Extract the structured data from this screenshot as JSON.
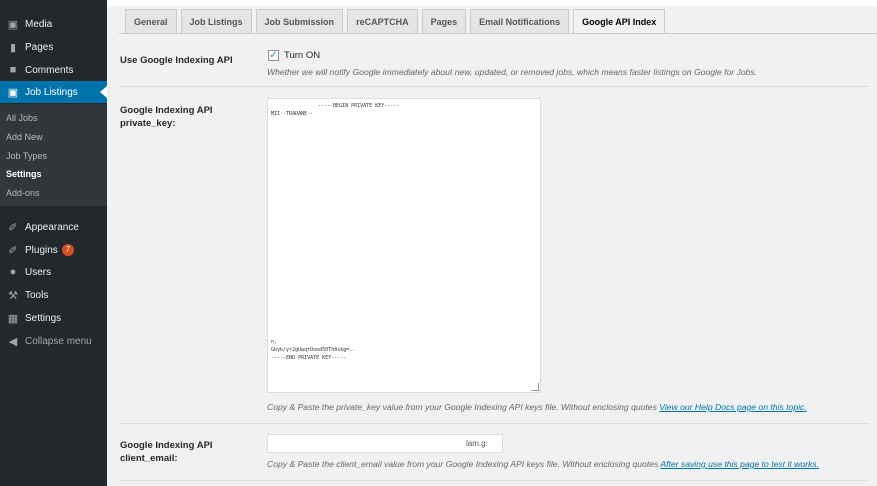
{
  "sidebar": {
    "items_top": [
      {
        "label": "Media",
        "icon": "media-icon"
      },
      {
        "label": "Pages",
        "icon": "pages-icon"
      },
      {
        "label": "Comments",
        "icon": "comments-icon"
      }
    ],
    "active": {
      "label": "Job Listings",
      "icon": "briefcase-icon"
    },
    "submenu": [
      "All Jobs",
      "Add New",
      "Job Types",
      "Settings",
      "Add-ons"
    ],
    "submenu_current": "Settings",
    "items_bottom": [
      {
        "label": "Appearance",
        "icon": "paintbrush-icon"
      },
      {
        "label": "Plugins",
        "icon": "plugin-icon",
        "badge": "7"
      },
      {
        "label": "Users",
        "icon": "users-icon"
      },
      {
        "label": "Tools",
        "icon": "wrench-icon"
      },
      {
        "label": "Settings",
        "icon": "settings-icon"
      }
    ],
    "collapse_label": "Collapse menu"
  },
  "tabs": [
    {
      "label": "General"
    },
    {
      "label": "Job Listings"
    },
    {
      "label": "Job Submission"
    },
    {
      "label": "reCAPTCHA"
    },
    {
      "label": "Pages"
    },
    {
      "label": "Email Notifications"
    },
    {
      "label": "Google API Index",
      "active": true
    }
  ],
  "settings": {
    "use_api": {
      "label": "Use Google Indexing API",
      "checkbox_checked": true,
      "checkbox_label": "Turn ON",
      "description": "Whether we will notify Google immediately about new, updated, or removed jobs, which means faster listings on Google for Jobs."
    },
    "private_key": {
      "label_line1": "Google Indexing API",
      "label_line2": "private_key:",
      "value_begin": "-----BEGIN PRIVATE KEY-----",
      "value_line2": "MII··TRADANE··",
      "value_end1": "n.",
      "value_end2": "Gbyb/yr2gUwqtOood50Th8skg=..",
      "value_end3": "-----END PRIVATE KEY-----",
      "description": "Copy & Paste the private_key value from your Google Indexing API keys file. Without enclosing quotes",
      "link": "View our Help Docs page on this topic."
    },
    "client_email": {
      "label_line1": "Google Indexing API",
      "label_line2": "client_email:",
      "value": "lam.g:",
      "description": "Copy & Paste the client_email value from your Google Indexing API keys file. Without enclosing quotes",
      "link": "After saving use this page to test it works."
    }
  }
}
